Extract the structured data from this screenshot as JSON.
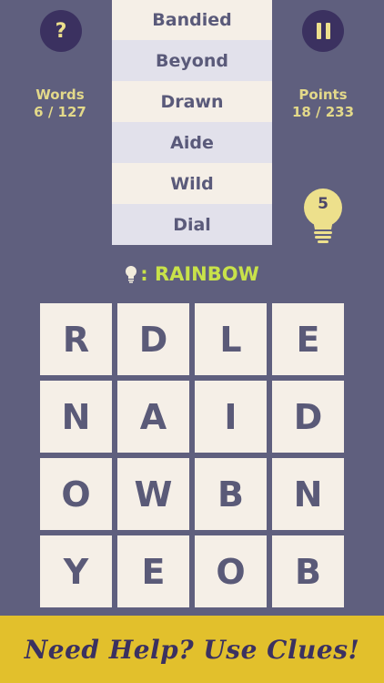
{
  "header": {
    "help_label": "?",
    "words_label": "Words",
    "words_value": "6 / 127",
    "points_label": "Points",
    "points_value": "18 / 233"
  },
  "found_words": [
    "Bandied",
    "Beyond",
    "Drawn",
    "Aide",
    "Wild",
    "Dial"
  ],
  "hint": {
    "count": "5",
    "clue_prefix": ": ",
    "clue_word": "RAINBOW"
  },
  "grid": [
    [
      "R",
      "D",
      "L",
      "E"
    ],
    [
      "N",
      "A",
      "I",
      "D"
    ],
    [
      "O",
      "W",
      "B",
      "N"
    ],
    [
      "Y",
      "E",
      "O",
      "B"
    ]
  ],
  "banner": {
    "text": "Need Help? Use Clues!"
  },
  "colors": {
    "background": "#5f5f7e",
    "button": "#3b3160",
    "accent_yellow": "#ede08c",
    "clue_green": "#c8e24a",
    "banner": "#e2c02c",
    "tile": "#f5efe7"
  },
  "icons": {
    "help": "question-icon",
    "pause": "pause-icon",
    "hint": "lightbulb-icon"
  }
}
